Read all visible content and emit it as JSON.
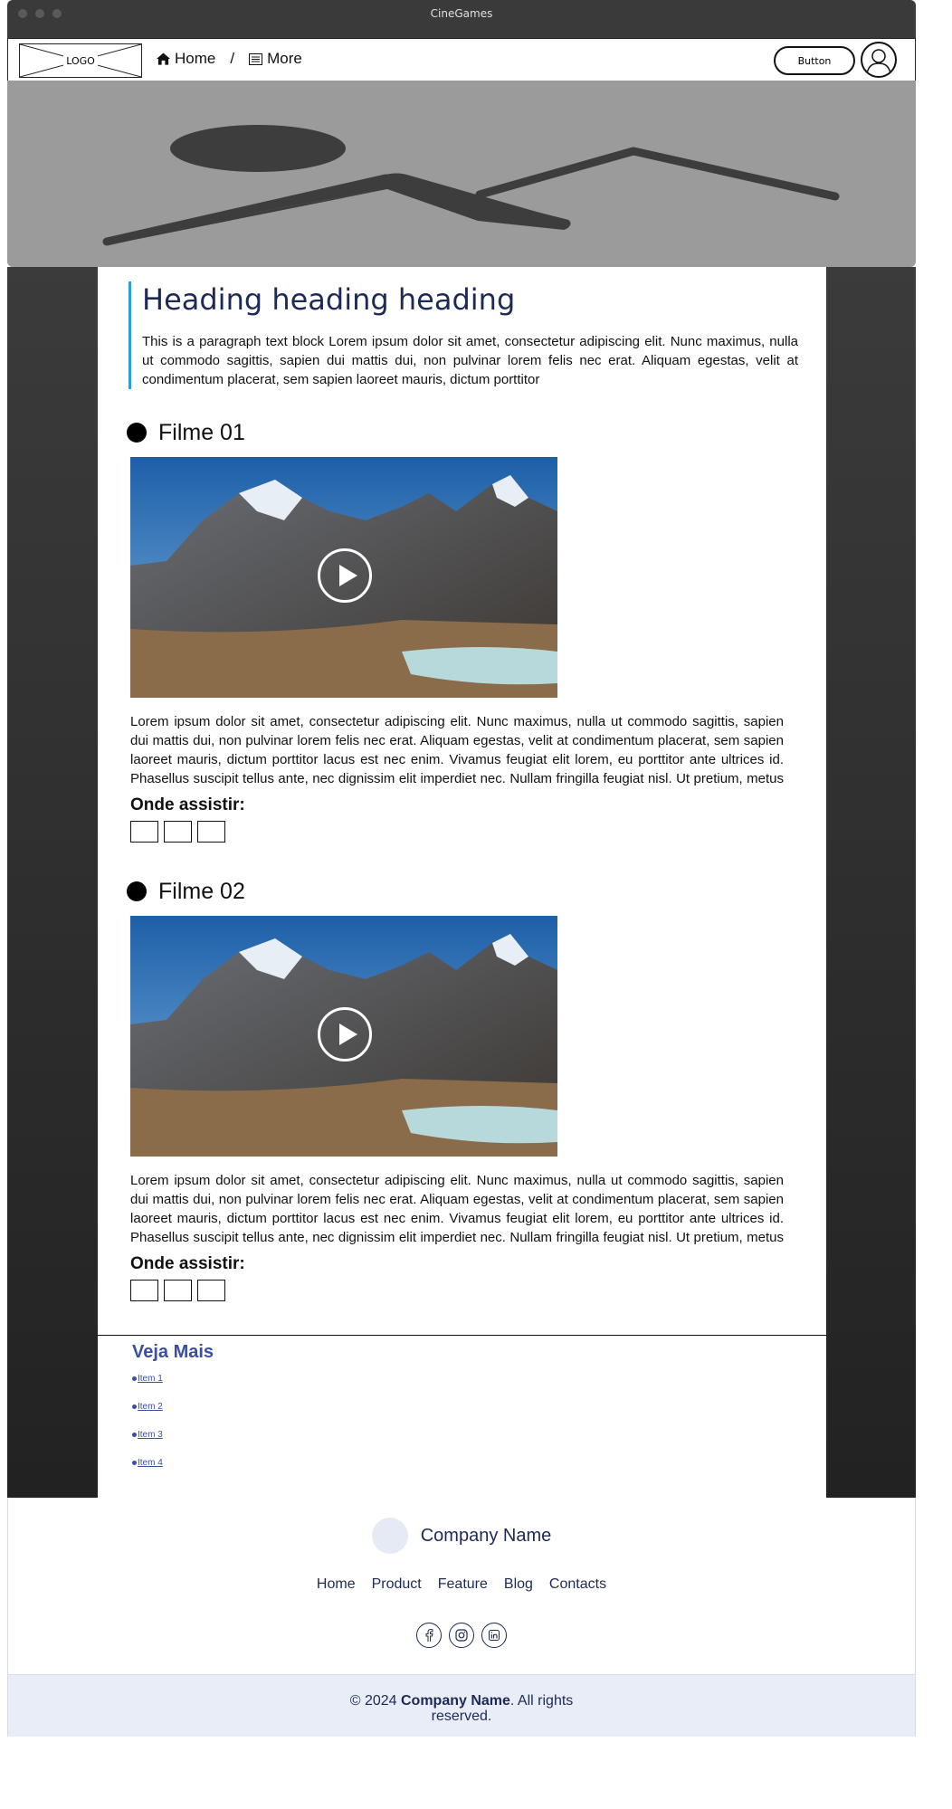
{
  "window": {
    "title": "CineGames"
  },
  "nav": {
    "logo": "LOGO",
    "crumbs": [
      {
        "label": "Home",
        "icon": "home-icon"
      },
      {
        "label": "More",
        "icon": "list-icon"
      }
    ],
    "separator": "/",
    "button": "Button",
    "avatar_icon": "user-avatar-icon"
  },
  "hero": {
    "icon": "image-placeholder-icon"
  },
  "intro": {
    "heading": "Heading heading heading",
    "paragraph": "This is a paragraph text block Lorem ipsum dolor sit amet, consectetur adipiscing elit. Nunc maximus, nulla ut commodo sagittis, sapien dui mattis dui, non pulvinar lorem felis nec erat. Aliquam egestas, velit at condimentum placerat, sem sapien laoreet mauris, dictum porttitor"
  },
  "films": [
    {
      "title": "Filme 01",
      "text": "Lorem ipsum dolor sit amet, consectetur adipiscing elit. Nunc maximus, nulla ut commodo sagittis, sapien dui mattis dui, non pulvinar lorem felis nec erat. Aliquam egestas, velit at condimentum placerat, sem sapien laoreet mauris, dictum porttitor lacus est nec enim. Vivamus feugiat elit lorem, eu porttitor ante ultrices id. Phasellus suscipit tellus ante, nec dignissim elit imperdiet nec. Nullam fringilla feugiat nisl. Ut pretium, metus venenatis dictum",
      "where_label": "Onde assistir:"
    },
    {
      "title": "Filme 02",
      "text": "Lorem ipsum dolor sit amet, consectetur adipiscing elit. Nunc maximus, nulla ut commodo sagittis, sapien dui mattis dui, non pulvinar lorem felis nec erat. Aliquam egestas, velit at condimentum placerat, sem sapien laoreet mauris, dictum porttitor lacus est nec enim. Vivamus feugiat elit lorem, eu porttitor ante ultrices id. Phasellus suscipit tellus ante, nec dignissim elit imperdiet nec. Nullam fringilla feugiat nisl. Ut pretium, metus venenatis dictum",
      "where_label": "Onde assistir:"
    }
  ],
  "see_more": {
    "title": "Veja Mais",
    "items": [
      "Item 1",
      "Item 2",
      "Item 3",
      "Item 4"
    ]
  },
  "footer": {
    "company": "Company Name",
    "links": [
      "Home",
      "Product",
      "Feature",
      "Blog",
      "Contacts"
    ],
    "social": [
      "facebook-icon",
      "instagram-icon",
      "linkedin-icon"
    ],
    "copyright_prefix": "© 2024 ",
    "copyright_company": "Company Name",
    "copyright_suffix": ". All rights reserved."
  },
  "colors": {
    "heading": "#1d2a55",
    "accent_bar": "#28a0d8",
    "link": "#3a4ea6",
    "footer_bg": "#e9edf7"
  }
}
